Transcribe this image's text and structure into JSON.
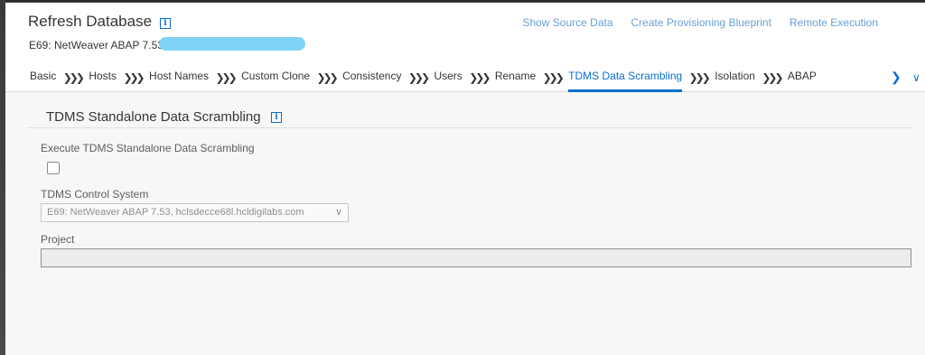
{
  "header": {
    "title": "Refresh Database",
    "subtitle": "E69: NetWeaver ABAP 7.53,",
    "links": [
      "Show Source Data",
      "Create Provisioning Blueprint",
      "Remote Execution"
    ]
  },
  "tabs": [
    {
      "label": "Basic",
      "active": false
    },
    {
      "label": "Hosts",
      "active": false
    },
    {
      "label": "Host Names",
      "active": false
    },
    {
      "label": "Custom Clone",
      "active": false
    },
    {
      "label": "Consistency",
      "active": false
    },
    {
      "label": "Users",
      "active": false
    },
    {
      "label": "Rename",
      "active": false
    },
    {
      "label": "TDMS Data Scrambling",
      "active": true
    },
    {
      "label": "Isolation",
      "active": false
    },
    {
      "label": "ABAP",
      "active": false
    }
  ],
  "tab_separator": "❯❯❯",
  "icons": {
    "info": "info-icon",
    "next": "chevron-right-icon",
    "overflow": "chevron-down-icon"
  },
  "section": {
    "title": "TDMS Standalone Data Scrambling",
    "execute_label": "Execute TDMS Standalone Data Scrambling",
    "execute_checked": false,
    "control_system_label": "TDMS Control System",
    "control_system_value": "E69: NetWeaver ABAP 7.53, hclsdecce68l.hcldigilabs.com",
    "project_label": "Project",
    "project_value": ""
  },
  "colors": {
    "accent": "#0a6ed1",
    "link": "#6a9fd3",
    "redaction": "#7fd3f5"
  }
}
